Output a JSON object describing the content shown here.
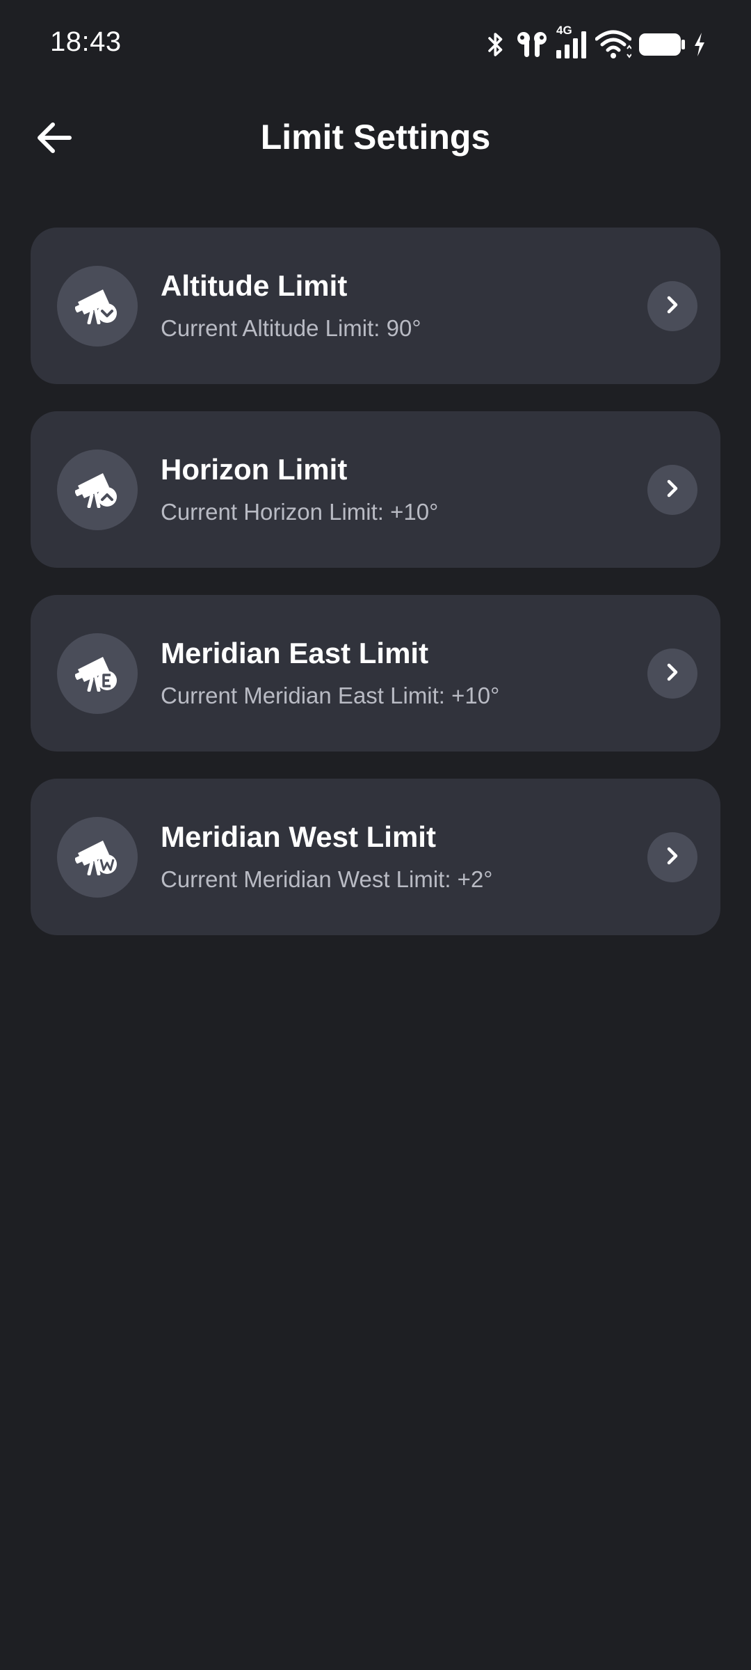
{
  "status_bar": {
    "time": "18:43",
    "network_label": "4G",
    "icons": [
      "bluetooth-icon",
      "earbuds-icon",
      "cellular-signal-icon",
      "wifi-icon",
      "battery-icon",
      "charging-icon"
    ]
  },
  "header": {
    "title": "Limit Settings",
    "back_icon": "arrow-left-icon"
  },
  "limits": [
    {
      "title": "Altitude Limit",
      "subtitle": "Current Altitude Limit: 90°",
      "icon": "telescope-altitude-icon",
      "badge": "chevron-down"
    },
    {
      "title": "Horizon Limit",
      "subtitle": "Current Horizon Limit: +10°",
      "icon": "telescope-horizon-icon",
      "badge": "chevron-up"
    },
    {
      "title": "Meridian East Limit",
      "subtitle": "Current Meridian East Limit: +10°",
      "icon": "telescope-east-icon",
      "badge": "E"
    },
    {
      "title": "Meridian West Limit",
      "subtitle": "Current Meridian West Limit: +2°",
      "icon": "telescope-west-icon",
      "badge": "W"
    }
  ],
  "colors": {
    "background": "#1e1f23",
    "card": "#31333c",
    "icon_circle": "#4a4d59",
    "text_primary": "#ffffff",
    "text_secondary": "#b9bbc4"
  }
}
